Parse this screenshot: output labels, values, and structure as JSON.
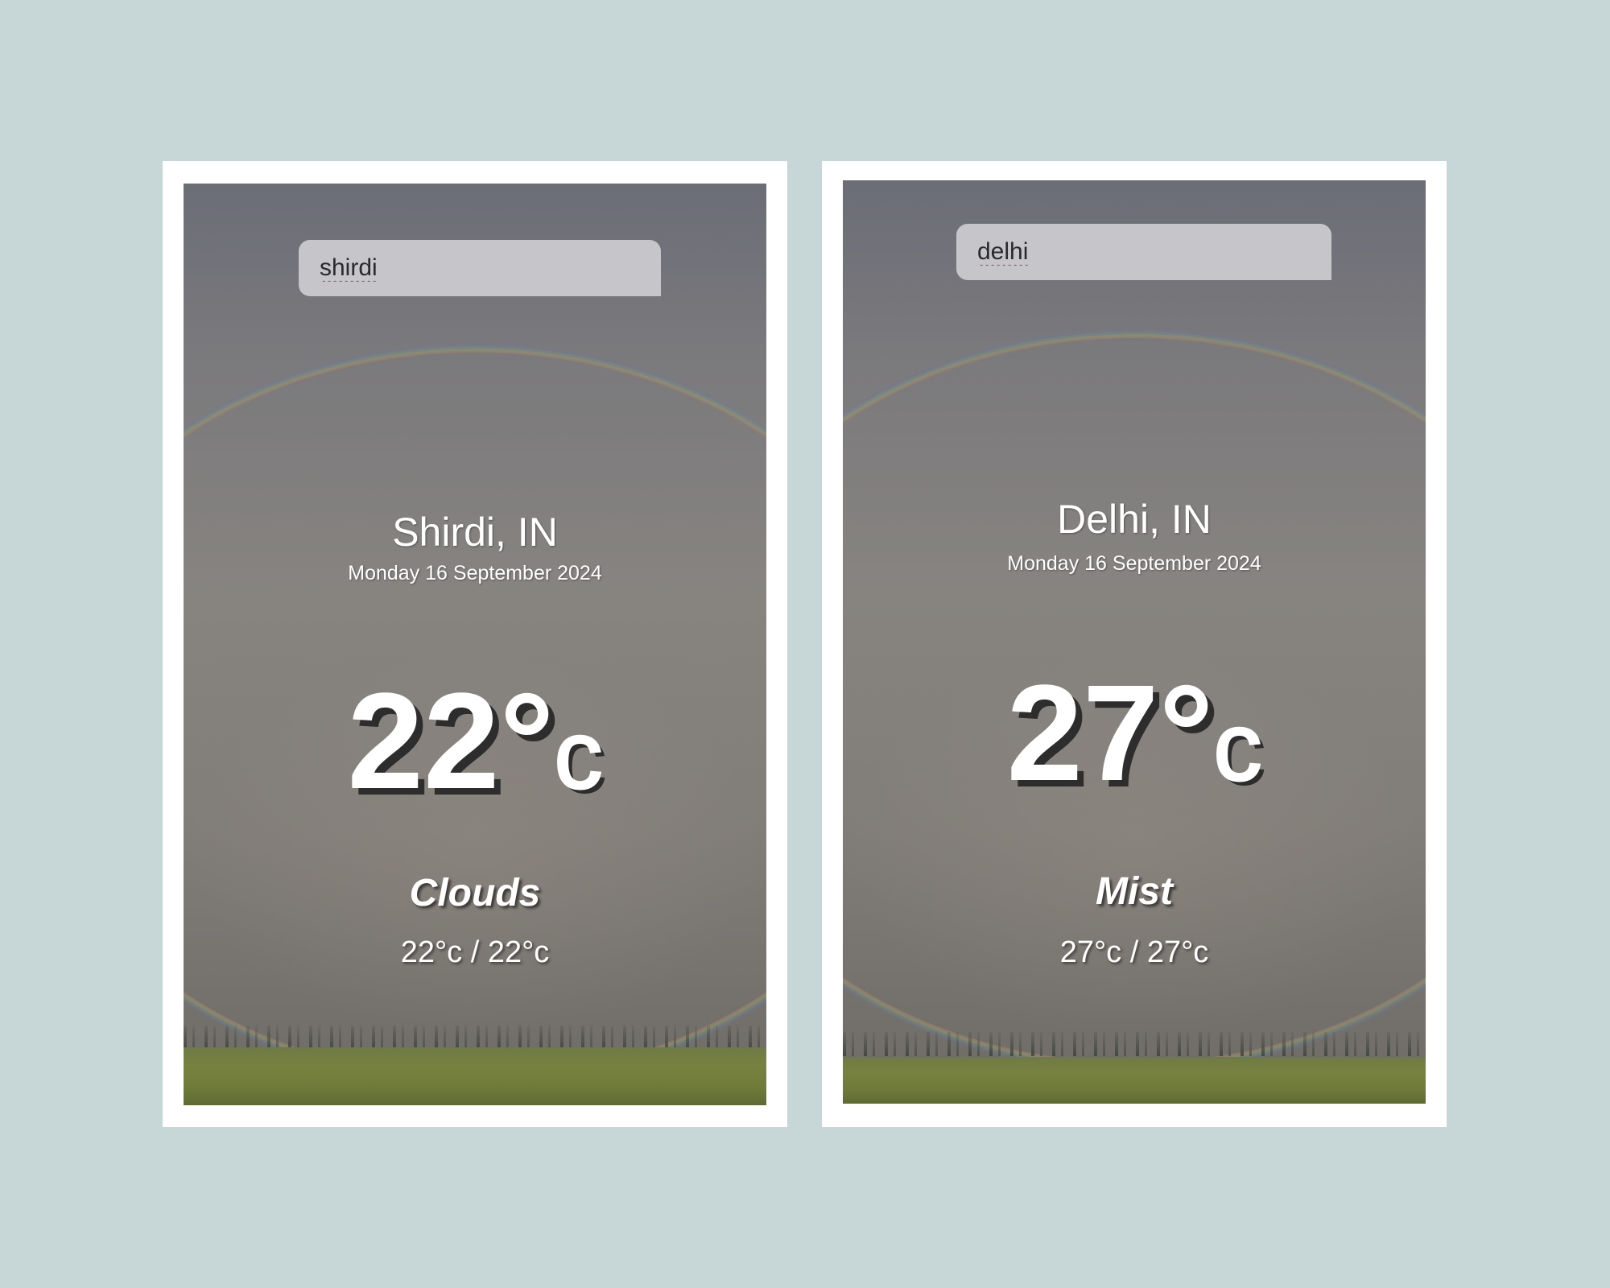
{
  "cards": [
    {
      "search": {
        "value": "shirdi"
      },
      "location": "Shirdi, IN",
      "date": "Monday 16 September 2024",
      "temperature": "22°",
      "unit": "c",
      "condition": "Clouds",
      "hi_lo": "22°c / 22°c"
    },
    {
      "search": {
        "value": "delhi"
      },
      "location": "Delhi, IN",
      "date": "Monday 16 September 2024",
      "temperature": "27°",
      "unit": "c",
      "condition": "Mist",
      "hi_lo": "27°c / 27°c"
    }
  ],
  "colors": {
    "page_background": "#c7d6d7",
    "frame": "#ffffff",
    "search_box": "#c6c5ca",
    "temperature_shadow": "#2d2d2d"
  }
}
